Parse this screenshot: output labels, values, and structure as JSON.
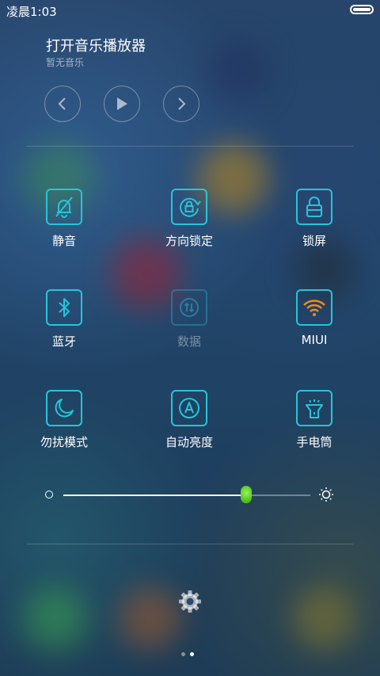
{
  "status_bar": {
    "time": "凌晨1:03"
  },
  "music": {
    "title": "打开音乐播放器",
    "subtitle": "暂无音乐"
  },
  "tiles": [
    {
      "label": "静音",
      "icon": "bell-off-icon",
      "enabled": true
    },
    {
      "label": "方向锁定",
      "icon": "rotation-lock-icon",
      "enabled": true
    },
    {
      "label": "锁屏",
      "icon": "lock-icon",
      "enabled": true
    },
    {
      "label": "蓝牙",
      "icon": "bluetooth-icon",
      "enabled": true
    },
    {
      "label": "数据",
      "icon": "mobile-data-icon",
      "enabled": false
    },
    {
      "label": "MIUI",
      "icon": "wifi-icon",
      "enabled": true
    },
    {
      "label": "勿扰模式",
      "icon": "moon-icon",
      "enabled": true
    },
    {
      "label": "自动亮度",
      "icon": "auto-brightness-icon",
      "enabled": true
    },
    {
      "label": "手电筒",
      "icon": "flashlight-icon",
      "enabled": true
    }
  ],
  "brightness": {
    "level": 0.74
  },
  "pager": {
    "count": 2,
    "active": 1
  },
  "colors": {
    "accent": "#27c4d9",
    "wifi": "#f08a1c",
    "slider_thumb": "#5fd22a"
  }
}
